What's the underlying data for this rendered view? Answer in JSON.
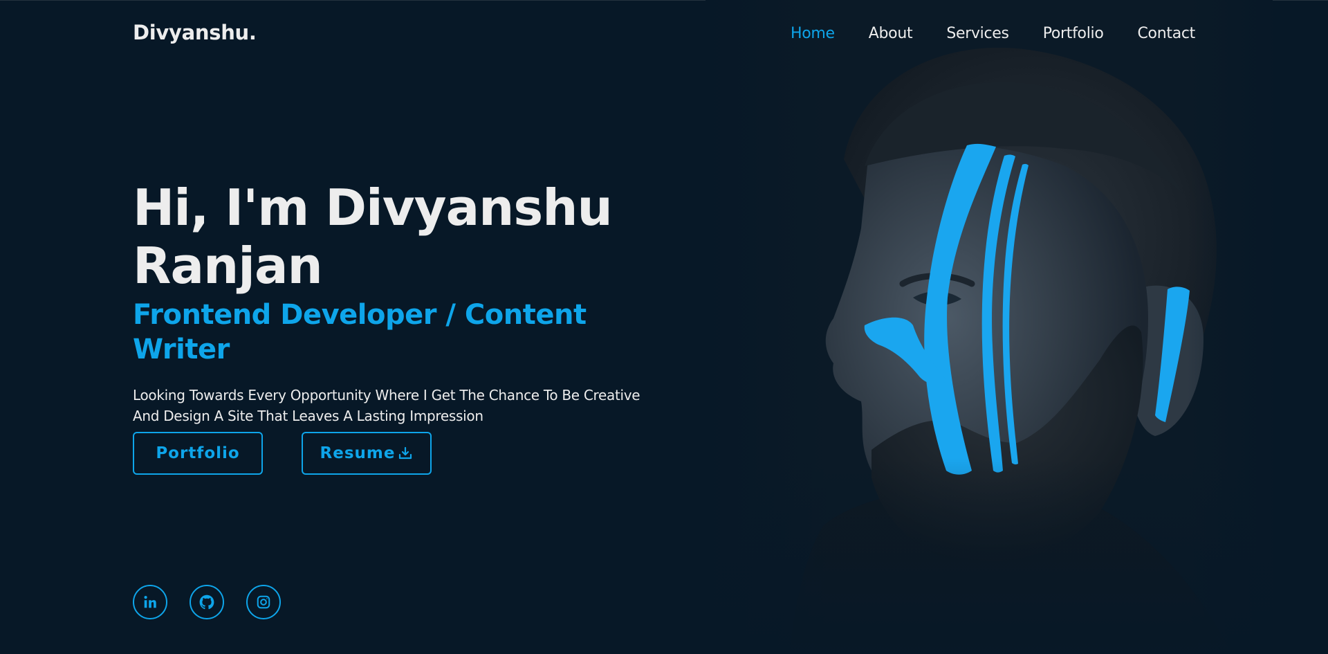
{
  "header": {
    "logo": "Divyanshu.",
    "nav": [
      {
        "label": "Home",
        "active": true
      },
      {
        "label": "About",
        "active": false
      },
      {
        "label": "Services",
        "active": false
      },
      {
        "label": "Portfolio",
        "active": false
      },
      {
        "label": "Contact",
        "active": false
      }
    ]
  },
  "hero": {
    "title_line1": "Hi, I'm Divyanshu",
    "title_line2": "Ranjan",
    "subtitle": "Frontend Developer / Content Writer",
    "description_line1": "Looking Towards Every Opportunity Where I Get The Chance To Be Creative",
    "description_line2": "And Design A Site That Leaves A Lasting Impression",
    "buttons": {
      "portfolio": "Portfolio",
      "resume": "Resume"
    }
  },
  "socials": [
    {
      "icon": "linkedin-icon"
    },
    {
      "icon": "github-icon"
    },
    {
      "icon": "instagram-icon"
    }
  ],
  "colors": {
    "background": "#071827",
    "accent": "#0ea5ea",
    "text": "#ededed"
  }
}
